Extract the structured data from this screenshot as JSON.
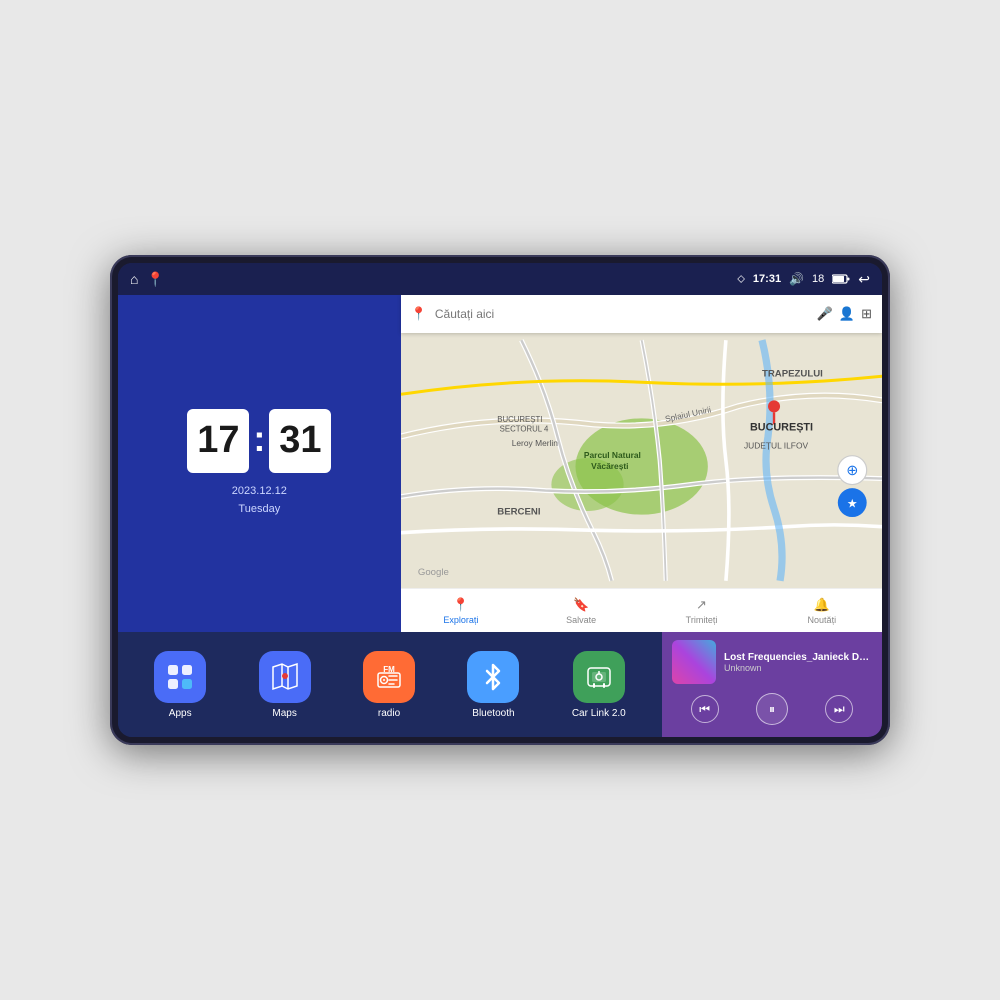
{
  "device": {
    "screen": {
      "status_bar": {
        "time": "17:31",
        "signal_strength": "18",
        "battery_text": "18"
      },
      "clock_widget": {
        "hours": "17",
        "minutes": "31",
        "date": "2023.12.12",
        "day": "Tuesday"
      },
      "map": {
        "search_placeholder": "Căutați aici",
        "labels": [
          "TRAPEZULUI",
          "BUCUREȘTI",
          "JUDEȚUL ILFOV",
          "BERCENI",
          "Parcul Natural Văcărești",
          "Leroy Merlin",
          "BUCUREȘTI SECTORUL 4",
          "Splaiul Unirii",
          "Google"
        ],
        "nav_items": [
          {
            "label": "Explorați",
            "active": true
          },
          {
            "label": "Salvate",
            "active": false
          },
          {
            "label": "Trimiteți",
            "active": false
          },
          {
            "label": "Noutăți",
            "active": false
          }
        ]
      },
      "apps": [
        {
          "label": "Apps",
          "icon": "apps",
          "color": "#4a6cf7"
        },
        {
          "label": "Maps",
          "icon": "maps",
          "color": "#4a6cf7"
        },
        {
          "label": "radio",
          "icon": "radio",
          "color": "#ff6b35"
        },
        {
          "label": "Bluetooth",
          "icon": "bluetooth",
          "color": "#4a9eff"
        },
        {
          "label": "Car Link 2.0",
          "icon": "carlink",
          "color": "#3fa05a"
        }
      ],
      "music_player": {
        "title": "Lost Frequencies_Janieck Devy-...",
        "artist": "Unknown",
        "controls": {
          "prev": "⏮",
          "play": "⏸",
          "next": "⏭"
        }
      }
    }
  }
}
